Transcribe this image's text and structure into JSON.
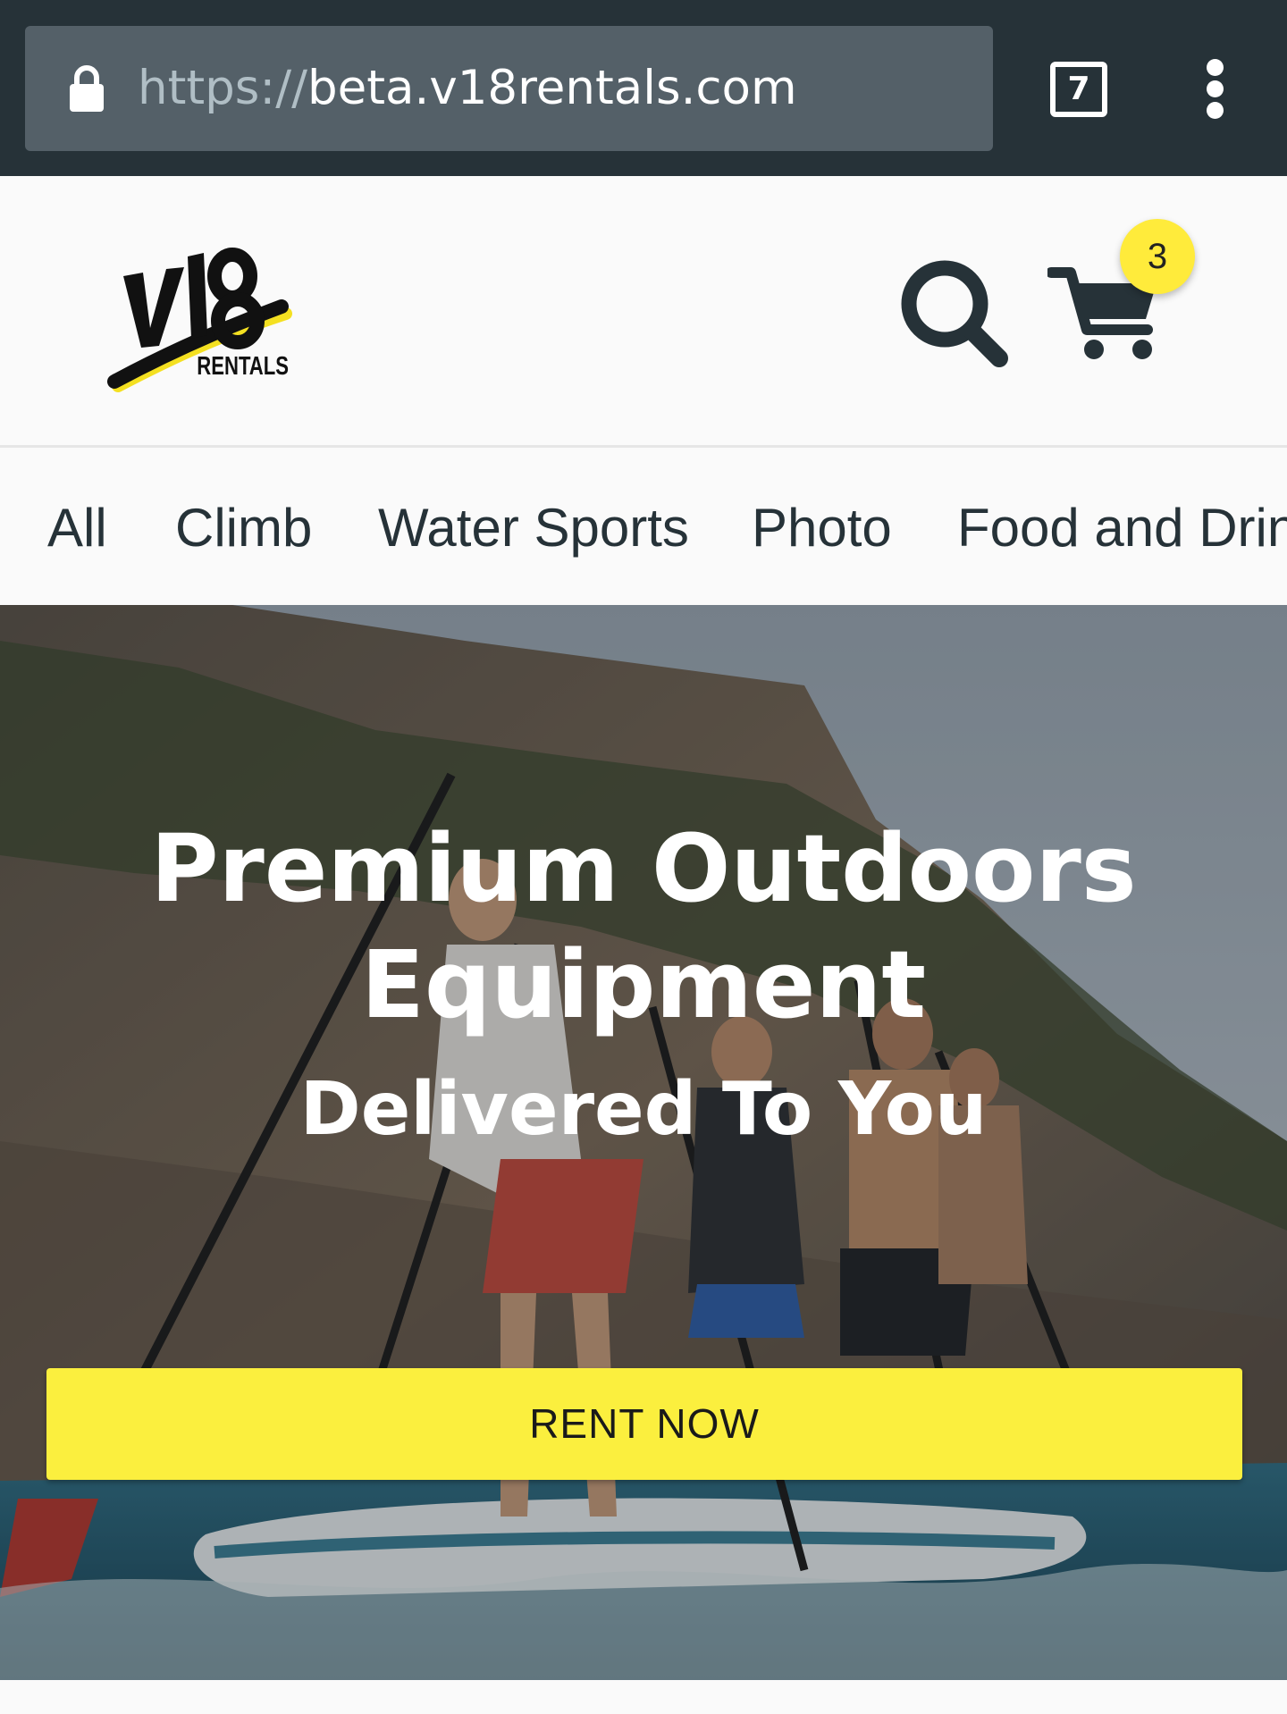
{
  "browser": {
    "url_scheme": "https://",
    "url_host": "beta.v18rentals.com",
    "tab_count": "7",
    "icons": {
      "lock": "lock-icon",
      "tabs": "tab-switcher-icon",
      "menu": "more-vert-icon"
    }
  },
  "header": {
    "logo_mark": "V18",
    "logo_text": "RENTALS",
    "cart_count": "3",
    "icons": {
      "search": "search-icon",
      "cart": "cart-icon"
    },
    "colors": {
      "badge": "#ffeb3b",
      "icon": "#263238"
    }
  },
  "categories": [
    "All",
    "Climb",
    "Water Sports",
    "Photo",
    "Food and Drink"
  ],
  "hero": {
    "title_line1": "Premium Outdoors",
    "title_line2": "Equipment",
    "subtitle": "Delivered To You",
    "cta_label": "RENT NOW",
    "colors": {
      "cta": "#fbef3e"
    }
  }
}
